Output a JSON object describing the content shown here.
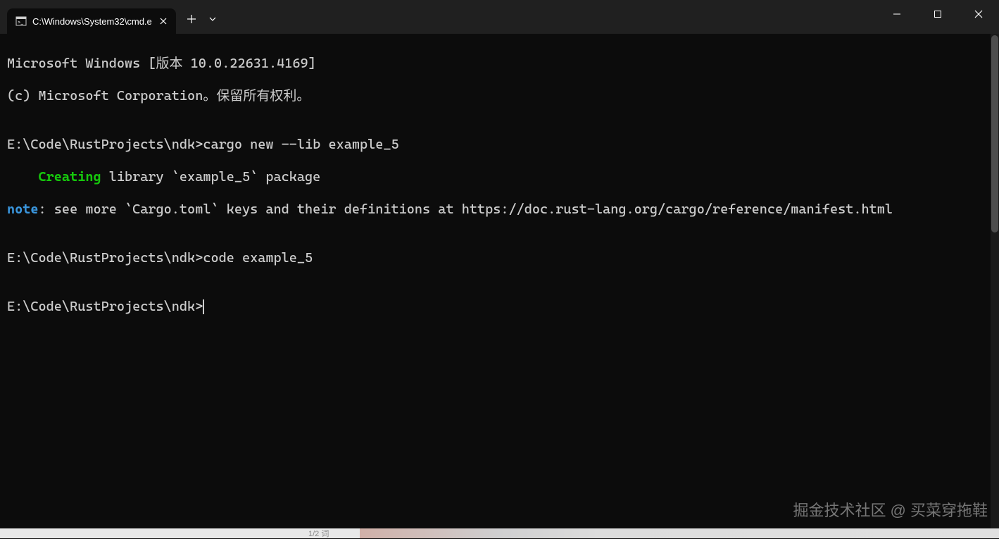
{
  "titlebar": {
    "tab_title": "C:\\Windows\\System32\\cmd.e",
    "icons": {
      "terminal": "terminal-icon",
      "close": "close-icon",
      "plus": "plus-icon",
      "chevron": "chevron-down-icon",
      "minimize": "minimize-icon",
      "maximize": "maximize-icon",
      "window_close": "close-icon"
    }
  },
  "terminal": {
    "line1": "Microsoft Windows [版本 10.0.22631.4169]",
    "line2": "(c) Microsoft Corporation。保留所有权利。",
    "blank": "",
    "prompt1_path": "E:\\Code\\RustProjects\\ndk>",
    "prompt1_cmd": "cargo new --lib example_5",
    "creating_indent": "    ",
    "creating_word": "Creating",
    "creating_rest": " library `example_5` package",
    "note_word": "note",
    "note_rest": ": see more `Cargo.toml` keys and their definitions at https://doc.rust-lang.org/cargo/reference/manifest.html",
    "prompt2_path": "E:\\Code\\RustProjects\\ndk>",
    "prompt2_cmd": "code example_5",
    "prompt3_path": "E:\\Code\\RustProjects\\ndk>"
  },
  "watermark": "掘金技术社区 @ 买菜穿拖鞋",
  "bottom_text": "1/2 词"
}
